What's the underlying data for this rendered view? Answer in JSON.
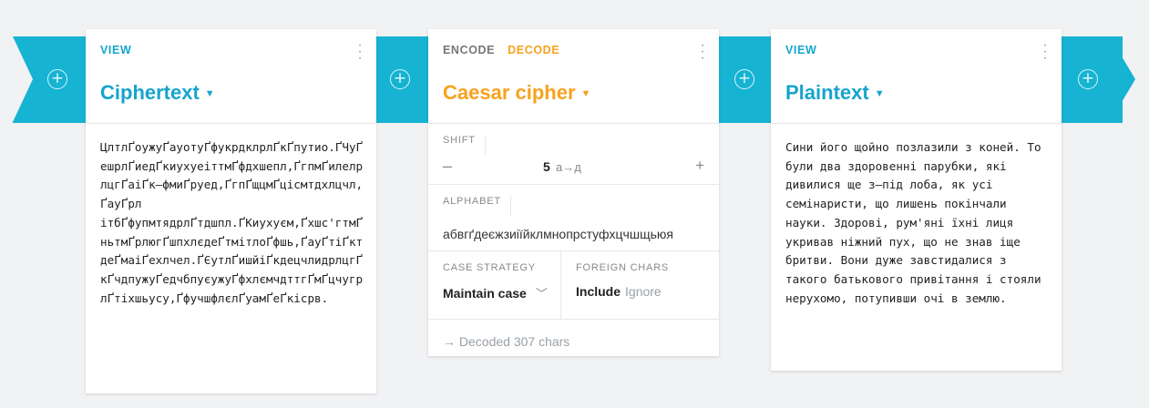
{
  "colors": {
    "accent": "#16b3d3",
    "encode_accent": "#f6a21e",
    "background": "#f1f2f4"
  },
  "pipeline": {
    "add_icon": "plus-circle-icon"
  },
  "cards": {
    "left": {
      "tab": "VIEW",
      "title": "Ciphertext",
      "content": "ЦлтлҐоужуҐауотуҐфукрдклрлҐкҐпутио.ҐЧуҐешрлҐиедҐкиухуеіттмҐфдхшепл,ҐгпмҐилелрлцгҐаіҐк–фмиҐруед,ҐгпҐщцмҐцісмтдхлцчл,ҐауҐрл\nітбҐфупмтядрлҐтдшпл.ҐКиухуєм,Ґхшс'гтмҐньтмҐрлюгҐшпхлєдеҐтмітлоҐфшь,ҐауҐтіҐктдеҐмаіҐехлчел.ҐЄутлҐишйіҐкдецчлидрлцгҐкҐчдпужуҐедчбпуєужуҐфхлємчдттгҐмҐцчугрлҐтіхшьусу,ҐфучшфлєлҐуамҐеҐкісрв."
    },
    "middle": {
      "tab_encode": "ENCODE",
      "tab_decode": "DECODE",
      "title": "Caesar cipher",
      "shift_label": "SHIFT",
      "shift_value": "5",
      "shift_mapping": "а→д",
      "alphabet_label": "ALPHABET",
      "alphabet_value": "абвгґдеєжзиіїйклмнопрстуфхцчшщьюя",
      "case_label": "CASE STRATEGY",
      "case_value": "Maintain case",
      "foreign_label": "FOREIGN CHARS",
      "foreign_include": "Include",
      "foreign_ignore": "Ignore",
      "status": "Decoded 307 chars"
    },
    "right": {
      "tab": "VIEW",
      "title": "Plaintext",
      "content": "Сини його щойно позлазили з коней. То були два здоровенні парубки, які дивилися ще з–під лоба, як усі семінаристи, що лишень покінчали науки. Здорові, рум'яні їхні лиця укривав ніжний пух, що не знав іще бритви. Вони дуже завстидалися з такого батькового привітання і стояли нерухомо, потупивши очі в землю."
    }
  }
}
